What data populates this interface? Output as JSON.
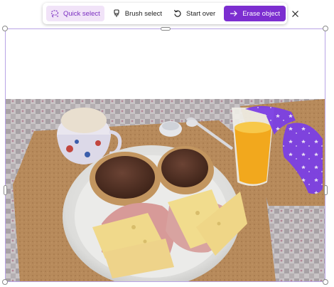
{
  "toolbar": {
    "quick_select": "Quick select",
    "brush_select": "Brush select",
    "start_over": "Start over",
    "erase_object": "Erase object"
  },
  "icons": {
    "quick_select": "lasso-sparkle-icon",
    "brush_select": "brush-icon",
    "start_over": "rotate-ccw-icon",
    "erase_object": "arrow-right-icon",
    "close": "close-icon"
  },
  "colors": {
    "accent": "#7c2ed0",
    "accent_light": "#f1e3f8",
    "selection_overlay": "#7b3fe4",
    "frame_border": "#b9a4e6"
  }
}
